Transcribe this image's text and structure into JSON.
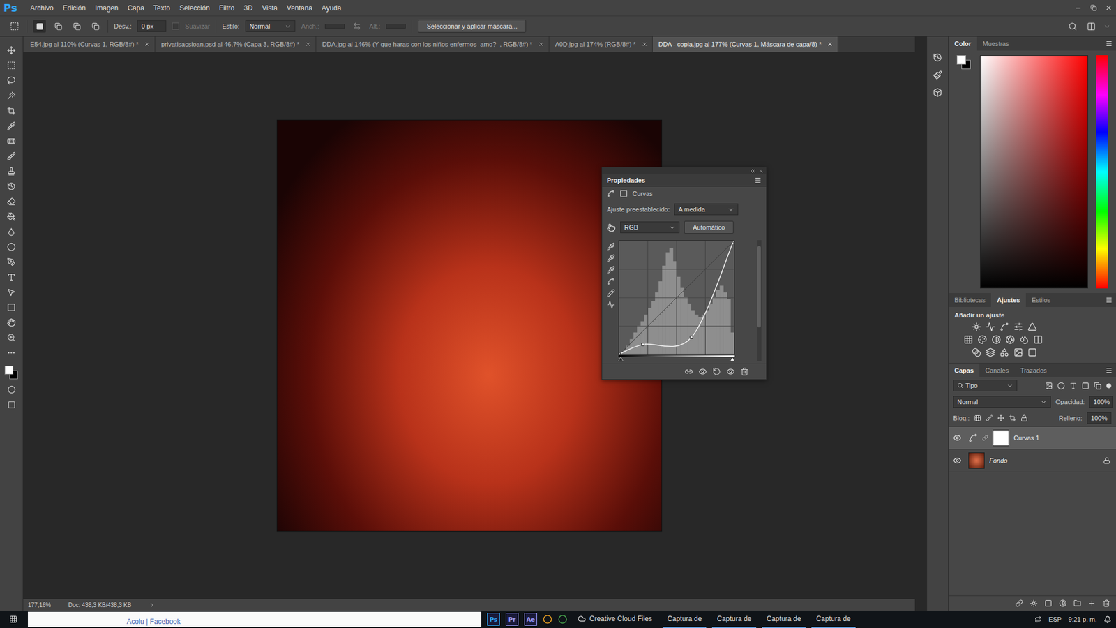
{
  "app": {
    "logo": "Ps"
  },
  "menu": [
    "Archivo",
    "Edición",
    "Imagen",
    "Capa",
    "Texto",
    "Selección",
    "Filtro",
    "3D",
    "Vista",
    "Ventana",
    "Ayuda"
  ],
  "options_bar": {
    "feather_label": "Desv.:",
    "feather_value": "0 px",
    "antialias": {
      "label": "Suavizar",
      "checked": false,
      "disabled": true
    },
    "style_label": "Estilo:",
    "style_value": "Normal",
    "width_label": "Anch.:",
    "height_label": "Alt.:",
    "mask_button": "Seleccionar y aplicar máscara..."
  },
  "document_tabs": [
    {
      "label": "E54.jpg al 110% (Curvas 1, RGB/8#) *",
      "selected": false
    },
    {
      "label": "privatisacsioan.psd al 46,7% (Capa 3, RGB/8#) *",
      "selected": false
    },
    {
      "label": "DDA.jpg al 146% (Y que haras con los niños enfermos  amo?  , RGB/8#) *",
      "selected": false
    },
    {
      "label": "A0D.jpg al 174% (RGB/8#) *",
      "selected": false
    },
    {
      "label": "DDA - copia.jpg al 177% (Curvas 1, Máscara de capa/8) *",
      "selected": true
    }
  ],
  "properties": {
    "title": "Propiedades",
    "adjustment": "Curvas",
    "preset_label": "Ajuste preestablecido:",
    "preset_value": "A medida",
    "channel": "RGB",
    "auto_button": "Automático",
    "curve_points": [
      [
        0,
        0
      ],
      [
        53,
        22
      ],
      [
        161,
        38
      ],
      [
        255,
        255
      ]
    ],
    "histogram": [
      2,
      4,
      8,
      14,
      20,
      26,
      30,
      36,
      42,
      48,
      56,
      66,
      80,
      92,
      96,
      84,
      70,
      60,
      52,
      46,
      40,
      36,
      34,
      36,
      40,
      46,
      52,
      58,
      62,
      56,
      50,
      20
    ]
  },
  "color_panel": {
    "tabs": [
      {
        "label": "Color",
        "selected": true
      },
      {
        "label": "Muestras",
        "selected": false
      }
    ]
  },
  "adjustments_panel": {
    "tabs": [
      {
        "label": "Bibliotecas",
        "selected": false
      },
      {
        "label": "Ajustes",
        "selected": true
      },
      {
        "label": "Estilos",
        "selected": false
      }
    ],
    "heading": "Añadir un ajuste"
  },
  "layers_panel": {
    "tabs": [
      {
        "label": "Capas",
        "selected": true
      },
      {
        "label": "Canales",
        "selected": false
      },
      {
        "label": "Trazados",
        "selected": false
      }
    ],
    "filter": "Tipo",
    "blend_mode": "Normal",
    "opacity_label": "Opacidad:",
    "opacity": "100%",
    "lock_label": "Bloq.:",
    "fill_label": "Relleno:",
    "fill": "100%",
    "layers": [
      {
        "name": "Curvas 1",
        "kind": "adjustment",
        "visible": true,
        "selected": true,
        "locked": false
      },
      {
        "name": "Fondo",
        "kind": "image",
        "visible": true,
        "selected": false,
        "locked": true
      }
    ]
  },
  "status_bar": {
    "zoom": "177,16%",
    "doc": "Doc: 438,3 KB/438,3 KB"
  },
  "taskbar": {
    "browser_window": "Acolu | Facebook",
    "apps": [
      {
        "label": "Ps",
        "color": "#31a8ff"
      },
      {
        "label": "Pr",
        "color": "#9999ff"
      },
      {
        "label": "Ae",
        "color": "#9999ff"
      }
    ],
    "cloud": "Creative Cloud Files",
    "captures": [
      "Captura de",
      "Captura de",
      "Captura de",
      "Captura de"
    ],
    "language": "ESP",
    "time": "9:21 p. m."
  }
}
